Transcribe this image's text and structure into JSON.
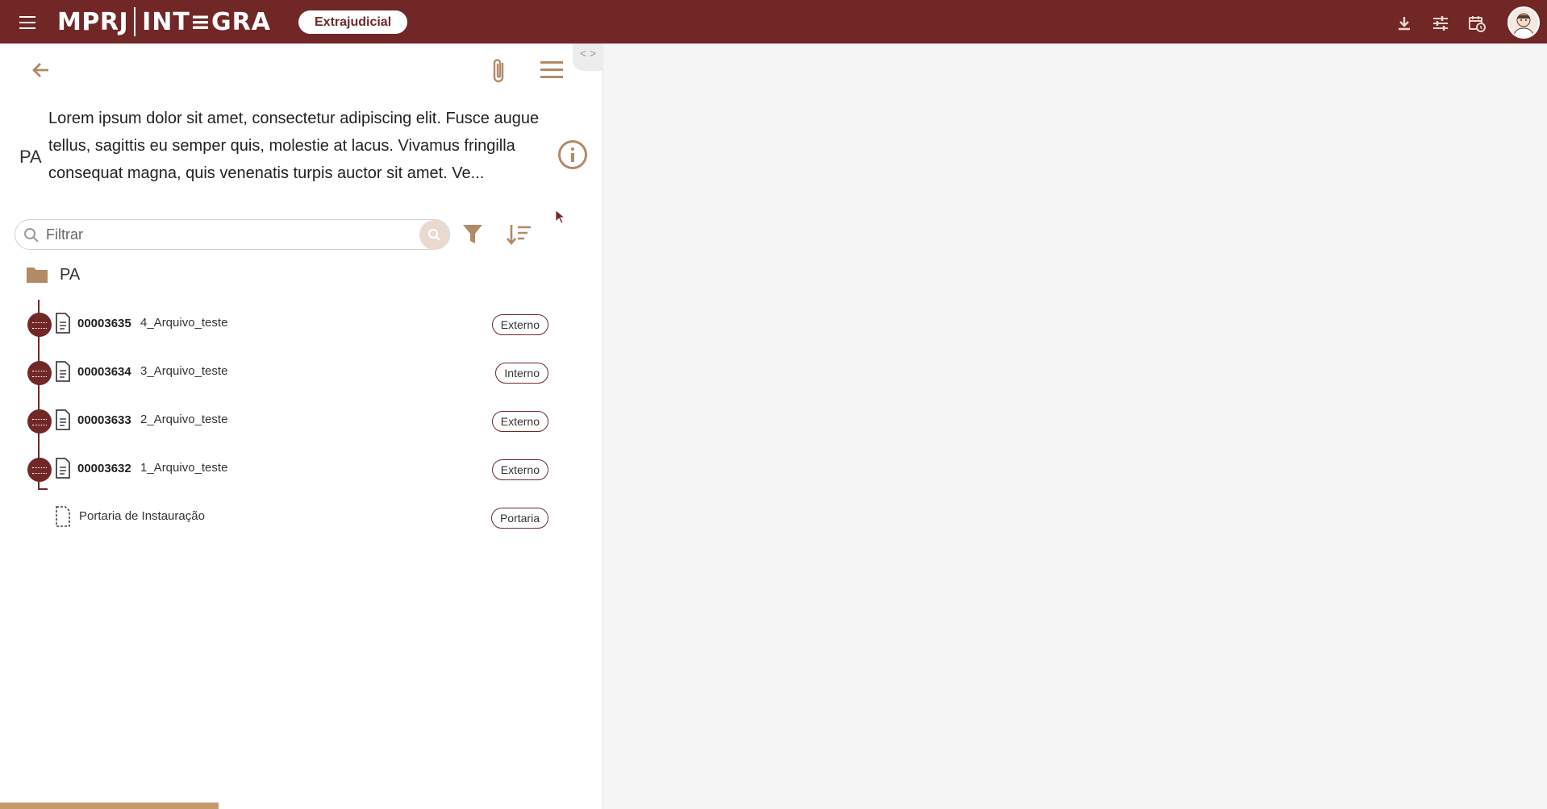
{
  "header": {
    "logo_left": "MPRJ",
    "logo_right": "INT≡GRA",
    "pill": "Extrajudicial"
  },
  "process": {
    "type": "PA",
    "description": "Lorem ipsum dolor sit amet, consectetur adipiscing elit. Fusce augue tellus, sagittis eu semper quis, molestie at lacus. Vivamus fringilla consequat magna, quis venenatis turpis auctor sit amet. Ve..."
  },
  "search": {
    "placeholder": "Filtrar"
  },
  "collapse_label": "< >",
  "tree": {
    "root_label": "PA",
    "items": [
      {
        "number": "00003635",
        "name": "4_Arquivo_teste",
        "badge": "Externo"
      },
      {
        "number": "00003634",
        "name": "3_Arquivo_teste",
        "badge": "Interno"
      },
      {
        "number": "00003633",
        "name": "2_Arquivo_teste",
        "badge": "Externo"
      },
      {
        "number": "00003632",
        "name": "1_Arquivo_teste",
        "badge": "Externo"
      }
    ],
    "last_item": {
      "name": "Portaria de Instauração",
      "badge": "Portaria"
    }
  },
  "colors": {
    "brand": "#722727",
    "accent": "#b08b66",
    "progress": "#c49a6c"
  },
  "icons": [
    "menu-icon",
    "download-icon",
    "sliders-icon",
    "calendar-clock-icon",
    "avatar",
    "arrow-left-icon",
    "paperclip-icon",
    "info-icon",
    "search-icon",
    "filter-icon",
    "sort-icon",
    "folder-icon",
    "document-icon",
    "document-dashed-icon"
  ]
}
